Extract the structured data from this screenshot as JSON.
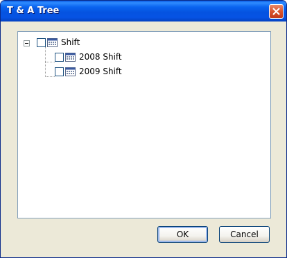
{
  "window": {
    "title": "T & A Tree"
  },
  "tree": {
    "root": {
      "label": "Shift",
      "expanded": true,
      "checked": false
    },
    "children": [
      {
        "label": "2008 Shift",
        "checked": false
      },
      {
        "label": "2009 Shift",
        "checked": false
      }
    ]
  },
  "buttons": {
    "ok": "OK",
    "cancel": "Cancel"
  },
  "colors": {
    "titlebar": "#0553e0",
    "close": "#d9542e",
    "panel_border": "#7f9db9"
  }
}
